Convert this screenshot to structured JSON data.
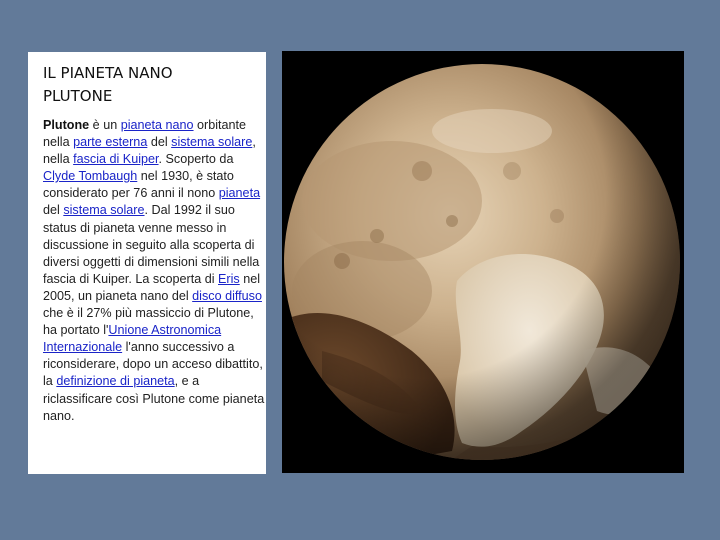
{
  "slide": {
    "title_line1": "IL PIANETA NANO",
    "title_line2": "PLUTONE"
  },
  "paragraph": [
    {
      "t": "b",
      "text": "Plutone"
    },
    {
      "t": "s",
      "text": " è un "
    },
    {
      "t": "a",
      "text": "pianeta nano"
    },
    {
      "t": "s",
      "text": " orbitante nella "
    },
    {
      "t": "a",
      "text": "parte esterna"
    },
    {
      "t": "s",
      "text": " del "
    },
    {
      "t": "a",
      "text": "sistema solare"
    },
    {
      "t": "s",
      "text": ", nella "
    },
    {
      "t": "a",
      "text": "fascia di Kuiper"
    },
    {
      "t": "s",
      "text": ". Scoperto da "
    },
    {
      "t": "a",
      "text": "Clyde Tombaugh"
    },
    {
      "t": "s",
      "text": " nel 1930, è stato considerato per 76 anni il nono "
    },
    {
      "t": "a",
      "text": "pianeta"
    },
    {
      "t": "s",
      "text": " del "
    },
    {
      "t": "a",
      "text": "sistema solare"
    },
    {
      "t": "s",
      "text": ". Dal 1992 il suo status di pianeta venne messo in discussione in seguito alla scoperta di diversi oggetti di dimensioni simili nella fascia di Kuiper. La scoperta di "
    },
    {
      "t": "a",
      "text": "Eris"
    },
    {
      "t": "s",
      "text": " nel 2005, un pianeta nano del "
    },
    {
      "t": "a",
      "text": "disco diffuso"
    },
    {
      "t": "s",
      "text": " che è il 27% più massiccio di Plutone, ha portato l'"
    },
    {
      "t": "a",
      "text": "Unione Astronomica Internazionale"
    },
    {
      "t": "s",
      "text": " l'anno successivo a riconsiderare, dopo un acceso dibattito, la "
    },
    {
      "t": "a",
      "text": "definizione di pianeta"
    },
    {
      "t": "s",
      "text": ", e a riclassificare così Plutone come pianeta nano."
    }
  ],
  "image": {
    "subject": "pluto-planet-photo"
  },
  "colors": {
    "background": "#627a99",
    "link": "#1a24c8",
    "text": "#222222"
  }
}
